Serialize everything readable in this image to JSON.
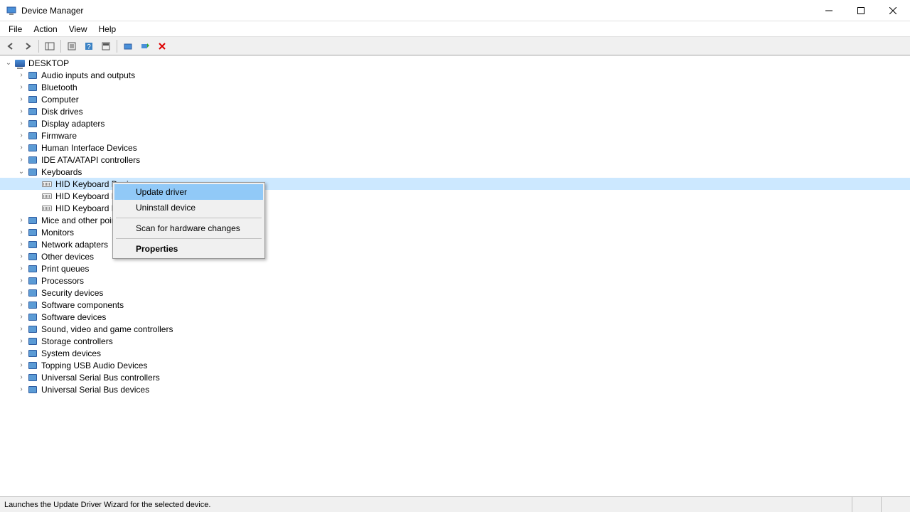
{
  "window": {
    "title": "Device Manager"
  },
  "menus": {
    "file": "File",
    "action": "Action",
    "view": "View",
    "help": "Help"
  },
  "tree": {
    "root": "DESKTOP",
    "categories": [
      {
        "label": "Audio inputs and outputs"
      },
      {
        "label": "Bluetooth"
      },
      {
        "label": "Computer"
      },
      {
        "label": "Disk drives"
      },
      {
        "label": "Display adapters"
      },
      {
        "label": "Firmware"
      },
      {
        "label": "Human Interface Devices"
      },
      {
        "label": "IDE ATA/ATAPI controllers"
      },
      {
        "label": "Keyboards",
        "expanded": true,
        "children": [
          "HID Keyboard Device",
          "HID Keyboard Device",
          "HID Keyboard Device"
        ]
      },
      {
        "label": "Mice and other pointing devices"
      },
      {
        "label": "Monitors"
      },
      {
        "label": "Network adapters"
      },
      {
        "label": "Other devices"
      },
      {
        "label": "Print queues"
      },
      {
        "label": "Processors"
      },
      {
        "label": "Security devices"
      },
      {
        "label": "Software components"
      },
      {
        "label": "Software devices"
      },
      {
        "label": "Sound, video and game controllers"
      },
      {
        "label": "Storage controllers"
      },
      {
        "label": "System devices"
      },
      {
        "label": "Topping USB Audio Devices"
      },
      {
        "label": "Universal Serial Bus controllers"
      },
      {
        "label": "Universal Serial Bus devices"
      }
    ]
  },
  "context_menu": {
    "update_driver": "Update driver",
    "uninstall_device": "Uninstall device",
    "scan_hardware": "Scan for hardware changes",
    "properties": "Properties"
  },
  "statusbar": {
    "text": "Launches the Update Driver Wizard for the selected device."
  }
}
